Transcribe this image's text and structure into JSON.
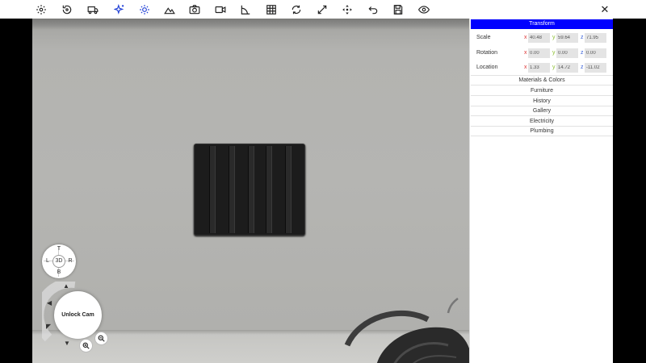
{
  "toolbar": {
    "icons": [
      {
        "name": "settings-icon",
        "active": false
      },
      {
        "name": "rotate-view-icon",
        "active": false
      },
      {
        "name": "vehicle-icon",
        "active": false
      },
      {
        "name": "sparkle-icon",
        "active": true
      },
      {
        "name": "sun-icon",
        "active": true
      },
      {
        "name": "terrain-icon",
        "active": false
      },
      {
        "name": "camera-icon",
        "active": false
      },
      {
        "name": "video-icon",
        "active": false
      },
      {
        "name": "measure-angle-icon",
        "active": false
      },
      {
        "name": "grid-icon",
        "active": false
      },
      {
        "name": "refresh-icon",
        "active": false
      },
      {
        "name": "resize-icon",
        "active": false
      },
      {
        "name": "move-icon",
        "active": false
      },
      {
        "name": "undo-icon",
        "active": false
      },
      {
        "name": "save-icon",
        "active": false
      },
      {
        "name": "eye-icon",
        "active": false
      }
    ],
    "close_icon": "close-icon",
    "active_color": "#1f3fd6"
  },
  "navigator": {
    "compass": {
      "top": "T",
      "left": "L",
      "right": "R",
      "bottom": "B",
      "center": "3D"
    },
    "unlock_label": "Unlock Cam",
    "zoom_in_icon": "zoom-in-icon",
    "zoom_out_icon": "zoom-out-icon"
  },
  "panel": {
    "header": "Transform",
    "header_color": "#0000ff",
    "transform": {
      "scale": {
        "label": "Scale",
        "x": "40.48",
        "y": "59.64",
        "z": "71.95"
      },
      "rotation": {
        "label": "Rotation",
        "x": "0.00",
        "y": "0.00",
        "z": "0.00"
      },
      "location": {
        "label": "Location",
        "x": "1.33",
        "y": "14.72",
        "z": "-11.02"
      }
    },
    "axis_labels": {
      "x": "x",
      "y": "y",
      "z": "z"
    },
    "sections": [
      "Materials & Colors",
      "Furniture",
      "History",
      "Gallery",
      "Electricity",
      "Plumbing"
    ]
  }
}
